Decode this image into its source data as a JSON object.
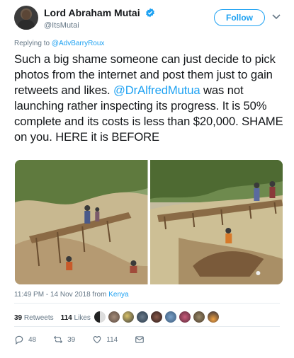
{
  "author": {
    "display_name": "Lord Abraham Mutai",
    "handle": "@ItsMutai",
    "verified_icon": "verified-badge-icon",
    "follow_label": "Follow"
  },
  "replying": {
    "prefix": "Replying to",
    "mention": "@AdvBarryRoux"
  },
  "tweet": {
    "text_before_mention": "Such a big shame someone  can just decide to pick photos from the internet and post them just to gain retweets and likes.",
    "mention": "@DrAlfredMutua",
    "text_after_mention": " was not launching rather inspecting its progress. It is 50% complete and its costs is less than $20,000. SHAME on you. HERE it is BEFORE"
  },
  "timestamp": {
    "time_date": "11:49 PM - 14 Nov 2018 from",
    "place": "Kenya"
  },
  "stats": {
    "retweets_count": "39",
    "retweets_label": "Retweets",
    "likes_count": "114",
    "likes_label": "Likes"
  },
  "actions": {
    "reply_count": "48",
    "retweet_count": "39",
    "like_count": "114"
  },
  "colors": {
    "accent": "#1da1f2",
    "text": "#14171a",
    "secondary": "#657786"
  }
}
